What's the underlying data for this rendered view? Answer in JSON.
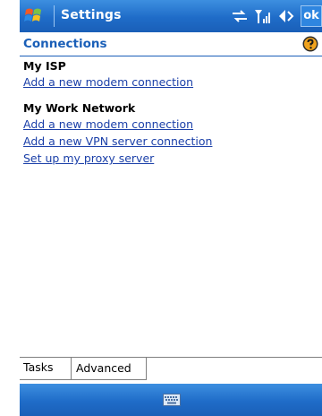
{
  "titlebar": {
    "title": "Settings",
    "ok_label": "ok"
  },
  "header": {
    "title": "Connections"
  },
  "sections": [
    {
      "title": "My ISP",
      "links": [
        "Add a new modem connection"
      ]
    },
    {
      "title": "My Work Network",
      "links": [
        "Add a new modem connection",
        "Add a new VPN server connection",
        "Set up my proxy server"
      ]
    }
  ],
  "tabs": [
    "Tasks",
    "Advanced"
  ],
  "colors": {
    "accent": "#1a5fb8",
    "link": "#1a3fa8"
  },
  "icons": [
    "windows-start-icon",
    "connectivity-icon",
    "signal-icon",
    "speaker-icon",
    "help-icon",
    "keyboard-icon"
  ]
}
